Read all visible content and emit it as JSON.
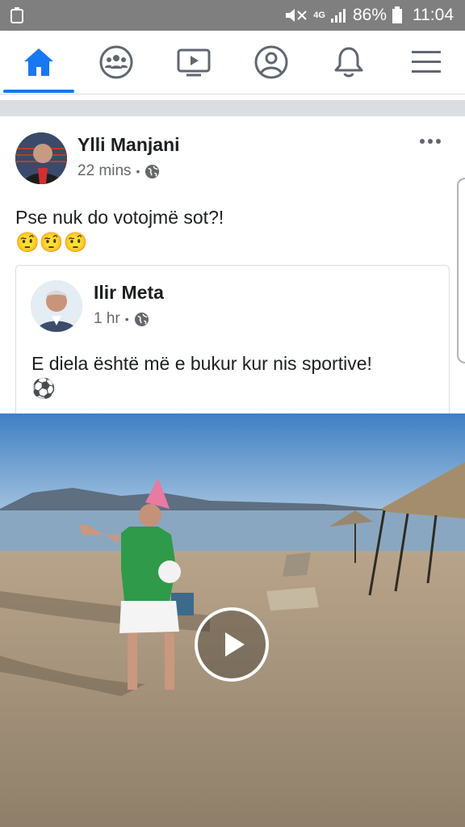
{
  "status_bar": {
    "battery_percent": "86%",
    "time": "11:04",
    "network": "4G",
    "icons": [
      "recycle-icon",
      "mute-icon",
      "signal-icon",
      "battery-icon"
    ]
  },
  "nav": {
    "tabs": [
      {
        "name": "home",
        "icon": "home-icon",
        "active": true
      },
      {
        "name": "groups",
        "icon": "groups-icon",
        "active": false
      },
      {
        "name": "watch",
        "icon": "video-icon",
        "active": false
      },
      {
        "name": "profile",
        "icon": "profile-icon",
        "active": false
      },
      {
        "name": "notifications",
        "icon": "bell-icon",
        "active": false
      },
      {
        "name": "menu",
        "icon": "menu-icon",
        "active": false
      }
    ],
    "accent": "#1877f2"
  },
  "post": {
    "author": "Ylli Manjani",
    "time": "22 mins",
    "separator": "•",
    "privacy_icon": "globe-icon",
    "text": "Pse nuk do votojmë sot?!",
    "emojis": "🤨🤨🤨",
    "shared": {
      "author": "Ilir Meta",
      "time": "1 hr",
      "separator": "•",
      "privacy_icon": "globe-icon",
      "text": "E diela është më e bukur kur nis sportive!",
      "emoji": "⚽"
    },
    "media": {
      "type": "video",
      "play_icon": "play-icon"
    }
  }
}
